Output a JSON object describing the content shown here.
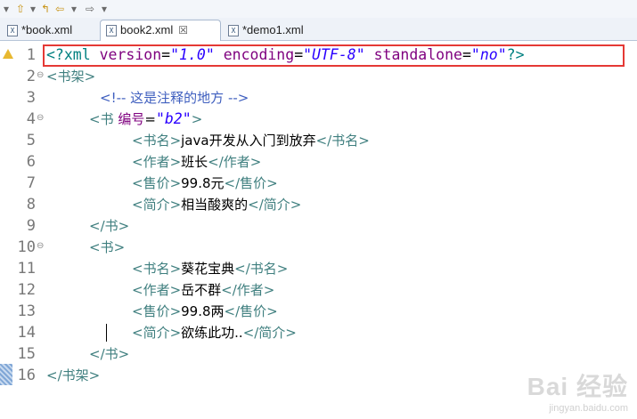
{
  "toolbar": {
    "icons": [
      "menu-arrow-icon",
      "upload-icon",
      "back-icon",
      "back-arrow-icon",
      "forward-arrow-icon"
    ]
  },
  "tabs": [
    {
      "label": "*book.xml",
      "active": false
    },
    {
      "label": "book2.xml",
      "active": true,
      "close": "☒"
    },
    {
      "label": "*demo1.xml",
      "active": false
    }
  ],
  "editor": {
    "lines": [
      {
        "n": "1"
      },
      {
        "n": "2"
      },
      {
        "n": "3"
      },
      {
        "n": "4"
      },
      {
        "n": "5"
      },
      {
        "n": "6"
      },
      {
        "n": "7"
      },
      {
        "n": "8"
      },
      {
        "n": "9"
      },
      {
        "n": "10"
      },
      {
        "n": "11"
      },
      {
        "n": "12"
      },
      {
        "n": "13"
      },
      {
        "n": "14"
      },
      {
        "n": "15"
      },
      {
        "n": "16"
      }
    ],
    "code": {
      "l1": {
        "open": "<?xml ",
        "a1": "version",
        "eq": "=",
        "v1": "\"1.0\"",
        "a2": "encoding",
        "v2": "\"UTF-8\"",
        "a3": "standalone",
        "v3": "\"no\"",
        "close": "?>"
      },
      "l2": {
        "tag": "<书架>"
      },
      "l3": {
        "comment": "<!-- 这是注释的地方 -->"
      },
      "l4": {
        "open": "<书 ",
        "attr": "编号",
        "eq": "=",
        "val": "\"b2\"",
        "close": ">"
      },
      "l5": {
        "o": "<书名>",
        "t": "java开发从入门到放弃",
        "c": "</书名>"
      },
      "l6": {
        "o": "<作者>",
        "t": "班长",
        "c": "</作者>"
      },
      "l7": {
        "o": "<售价>",
        "t": "99.8元",
        "c": "</售价>"
      },
      "l8": {
        "o": "<简介>",
        "t": "相当酸爽的",
        "c": "</简介>"
      },
      "l9": {
        "tag": "</书>"
      },
      "l10": {
        "tag": "<书>"
      },
      "l11": {
        "o": "<书名>",
        "t": "葵花宝典",
        "c": "</书名>"
      },
      "l12": {
        "o": "<作者>",
        "t": "岳不群",
        "c": "</作者>"
      },
      "l13": {
        "o": "<售价>",
        "t": "99.8两",
        "c": "</售价>"
      },
      "l14": {
        "o": "<简介>",
        "t": "欲练此功..",
        "c": "</简介>"
      },
      "l15": {
        "tag": "</书>"
      },
      "l16": {
        "tag": "</书架>"
      }
    }
  },
  "watermark": {
    "logo": "Bai 经验",
    "url": "jingyan.baidu.com"
  }
}
